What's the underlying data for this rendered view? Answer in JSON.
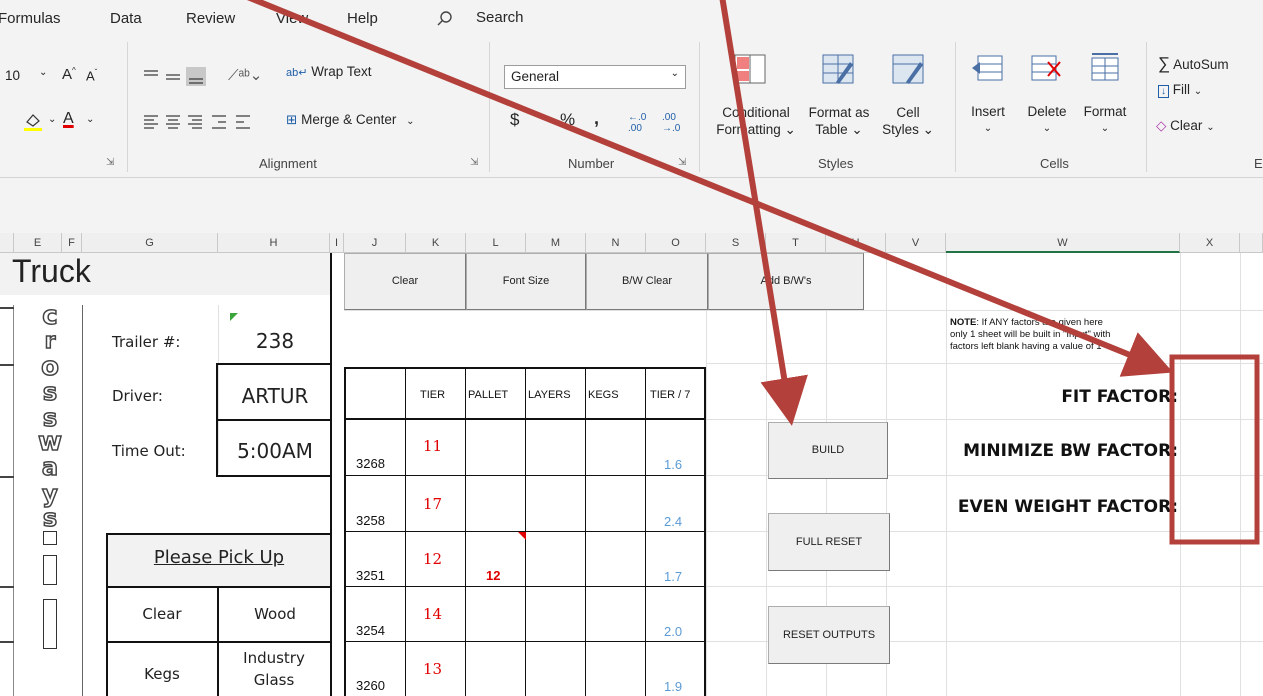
{
  "menu": {
    "formulas": "Formulas",
    "data": "Data",
    "review": "Review",
    "view": "View",
    "help": "Help",
    "search": "Search"
  },
  "ribbon": {
    "font_size": "10",
    "wrap_text": "Wrap Text",
    "merge_center": "Merge & Center",
    "number_format": "General",
    "alignment_label": "Alignment",
    "number_label": "Number",
    "styles_label": "Styles",
    "cells_label": "Cells",
    "cond_format_1": "Conditional",
    "cond_format_2": "Formatting",
    "format_table_1": "Format as",
    "format_table_2": "Table",
    "cell_styles_1": "Cell",
    "cell_styles_2": "Styles",
    "insert": "Insert",
    "delete": "Delete",
    "format": "Format",
    "autosum": "AutoSum",
    "fill": "Fill",
    "clear": "Clear",
    "editing_partial": "E"
  },
  "columns": [
    "E",
    "F",
    "G",
    "H",
    "I",
    "J",
    "K",
    "L",
    "M",
    "N",
    "O",
    "S",
    "T",
    "U",
    "V",
    "W",
    "X"
  ],
  "sheet": {
    "title": "Truck",
    "logo_letters": [
      "c",
      "r",
      "o",
      "s",
      "s",
      "w",
      "a",
      "y",
      "s"
    ],
    "trailer_label": "Trailer #:",
    "trailer_value": "238",
    "driver_label": "Driver:",
    "driver_value": "ARTUR",
    "timeout_label": "Time Out:",
    "timeout_value": "5:00AM",
    "pickup_label": "Please Pick Up",
    "pickup_items": [
      {
        "left": "Clear",
        "right": "Wood"
      },
      {
        "left": "Kegs",
        "right": "Industry Glass"
      }
    ],
    "buttons": {
      "clear": "Clear",
      "font_size": "Font Size",
      "bw_clear": "B/W Clear",
      "add_bws": "Add B/W's",
      "build": "BUILD",
      "full_reset": "FULL RESET",
      "reset_outputs": "RESET OUTPUTS"
    },
    "table_headers": [
      "TIER",
      "PALLET",
      "LAYERS",
      "KEGS",
      "TIER / 7"
    ],
    "rows": [
      {
        "id": "3268",
        "tier": "11",
        "pallet": "",
        "ratio": "1.6"
      },
      {
        "id": "3258",
        "tier": "17",
        "pallet": "",
        "ratio": "2.4"
      },
      {
        "id": "3251",
        "tier": "12",
        "pallet": "12",
        "ratio": "1.7"
      },
      {
        "id": "3254",
        "tier": "14",
        "pallet": "",
        "ratio": "2.0"
      },
      {
        "id": "3260",
        "tier": "13",
        "pallet": "",
        "ratio": "1.9"
      }
    ],
    "note_bold": "NOTE",
    "note_line1": ": If ANY factors are given here",
    "note_line2": "only 1 sheet will be built in \"Input\" with",
    "note_line3": "factors left blank having a value of 1",
    "fit_factor": "FIT FACTOR:",
    "minimize_bw_factor": "MINIMIZE BW FACTOR:",
    "even_weight_factor": "EVEN WEIGHT FACTOR:"
  },
  "annotation_color": "#b3403a"
}
